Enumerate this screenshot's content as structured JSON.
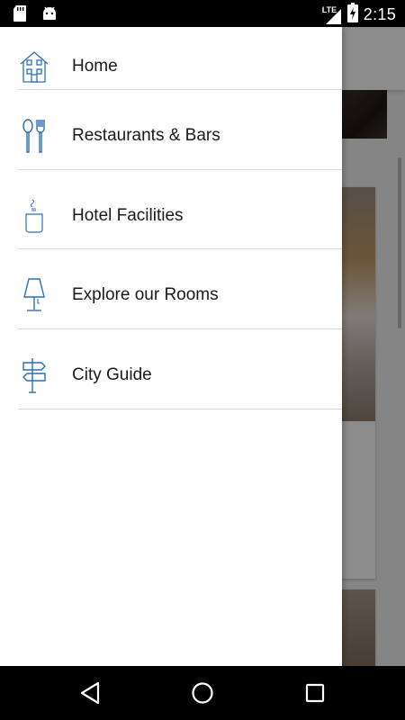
{
  "status_bar": {
    "time": "2:15",
    "network": "LTE",
    "left_icons": [
      "sd-card-icon",
      "android-icon"
    ],
    "right_icons": [
      "signal-icon",
      "battery-charging-icon"
    ]
  },
  "drawer": {
    "items": [
      {
        "label": "Home",
        "icon": "house-icon"
      },
      {
        "label": "Restaurants & Bars",
        "icon": "cutlery-icon"
      },
      {
        "label": "Hotel Facilities",
        "icon": "cup-icon"
      },
      {
        "label": "Explore our Rooms",
        "icon": "lamp-icon"
      },
      {
        "label": "City Guide",
        "icon": "signpost-icon"
      }
    ]
  },
  "nav_bar": {
    "buttons": [
      "back-button",
      "home-button",
      "recents-button"
    ]
  },
  "colors": {
    "accent_icon": "#2c6fb7",
    "drawer_bg": "#ffffff",
    "divider": "#d9d9d9",
    "status_bar_bg": "#000000"
  }
}
